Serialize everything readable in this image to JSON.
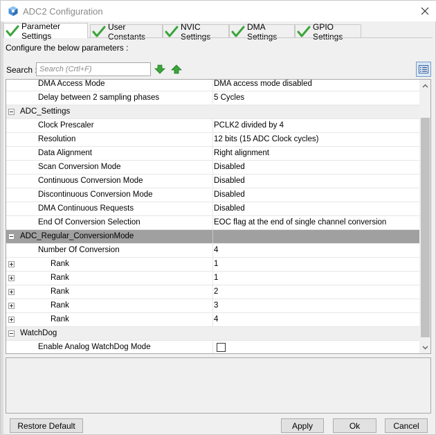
{
  "window": {
    "title": "ADC2 Configuration"
  },
  "tabs": [
    {
      "label": "Parameter Settings",
      "active": true
    },
    {
      "label": "User Constants",
      "active": false
    },
    {
      "label": "NVIC Settings",
      "active": false
    },
    {
      "label": "DMA Settings",
      "active": false
    },
    {
      "label": "GPIO Settings",
      "active": false
    }
  ],
  "description": "Configure the below parameters :",
  "search": {
    "label": "Search :",
    "placeholder": "Search (Crtl+F)",
    "value": ""
  },
  "parameters": {
    "row0": {
      "name": "DMA Access Mode",
      "value": "DMA access mode disabled"
    },
    "row1": {
      "name": "Delay between 2 sampling phases",
      "value": "5 Cycles"
    },
    "adc_settings": {
      "title": "ADC_Settings"
    },
    "row3": {
      "name": "Clock Prescaler",
      "value": "PCLK2 divided by 4"
    },
    "row4": {
      "name": "Resolution",
      "value": "12 bits (15 ADC Clock cycles)"
    },
    "row5": {
      "name": "Data Alignment",
      "value": "Right alignment"
    },
    "row6": {
      "name": "Scan Conversion Mode",
      "value": "Disabled"
    },
    "row7": {
      "name": "Continuous Conversion Mode",
      "value": "Disabled"
    },
    "row8": {
      "name": "Discontinuous Conversion Mode",
      "value": "Disabled"
    },
    "row9": {
      "name": "DMA Continuous Requests",
      "value": "Disabled"
    },
    "row10": {
      "name": "End Of Conversion Selection",
      "value": "EOC flag at the end of single channel conversion"
    },
    "regular": {
      "title": "ADC_Regular_ConversionMode"
    },
    "row12": {
      "name": "Number Of Conversion",
      "value": "4"
    },
    "ranks": [
      {
        "name": "Rank",
        "value": "1"
      },
      {
        "name": "Rank",
        "value": "1"
      },
      {
        "name": "Rank",
        "value": "2"
      },
      {
        "name": "Rank",
        "value": "3"
      },
      {
        "name": "Rank",
        "value": "4"
      }
    ],
    "watchdog": {
      "title": "WatchDog"
    },
    "row19": {
      "name": "Enable Analog WatchDog Mode",
      "checked": false
    }
  },
  "buttons": {
    "restore_default": "Restore Default",
    "apply": "Apply",
    "ok": "Ok",
    "cancel": "Cancel"
  },
  "icons": {
    "tab_check": "check-icon",
    "find_next": "arrow-down-icon",
    "find_prev": "arrow-up-icon",
    "view_toggle": "list-view-icon"
  },
  "colors": {
    "check_green": "#3aa53a",
    "selected_row": "#a0a0a0",
    "category_row": "#efefef"
  }
}
